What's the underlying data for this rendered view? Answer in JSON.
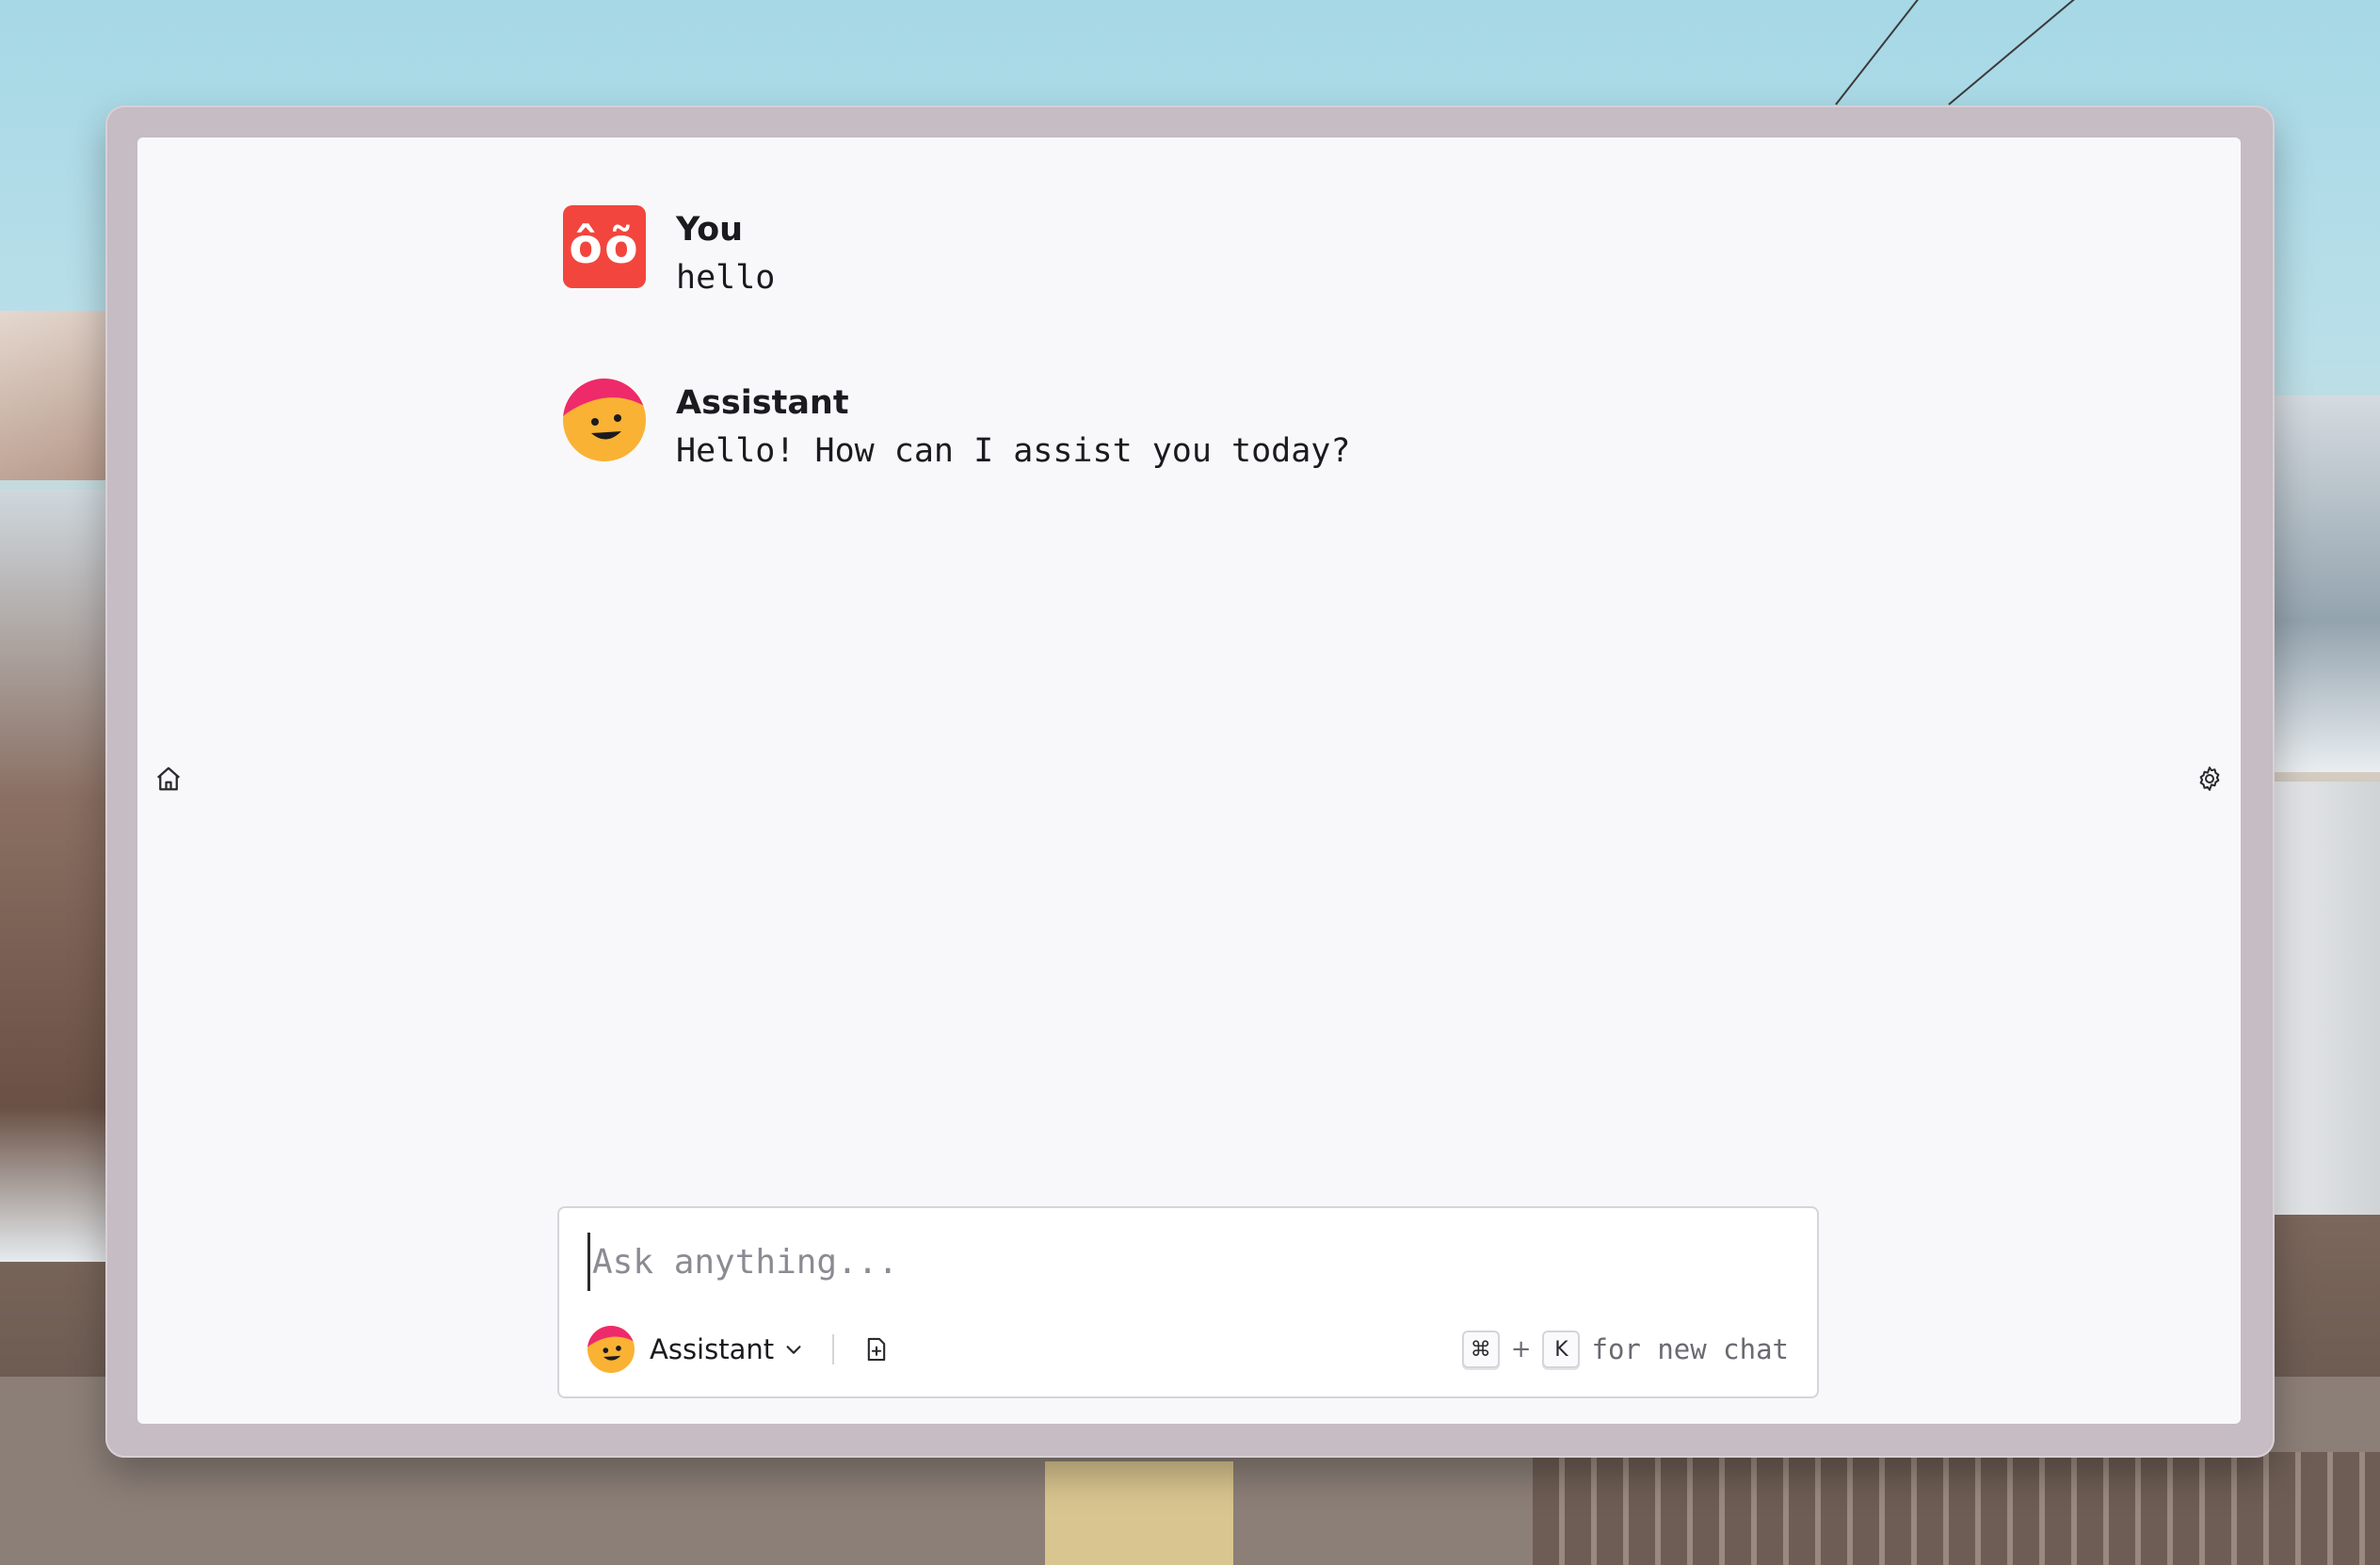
{
  "colors": {
    "user_avatar_bg": "#f2453d",
    "assistant_avatar_face": "#f9b233",
    "assistant_avatar_cap": "#ee2a6b",
    "panel_bg": "#f8f8fa",
    "window_frame": "#c6bcc4"
  },
  "sidebar": {
    "home_icon": "home-icon",
    "settings_icon": "gear-icon"
  },
  "messages": [
    {
      "author": "You",
      "text": "hello",
      "avatar": "user-avatar-logo",
      "avatar_glyph": "ôõ"
    },
    {
      "author": "Assistant",
      "text": "Hello! How can I assist you today?",
      "avatar": "assistant-smiley-avatar"
    }
  ],
  "composer": {
    "placeholder": "Ask anything...",
    "value": "",
    "assistant_label": "Assistant",
    "attach_icon": "file-plus-icon",
    "shortcut_key_1": "⌘",
    "shortcut_plus": "+",
    "shortcut_key_2": "K",
    "shortcut_text": "for new chat"
  }
}
